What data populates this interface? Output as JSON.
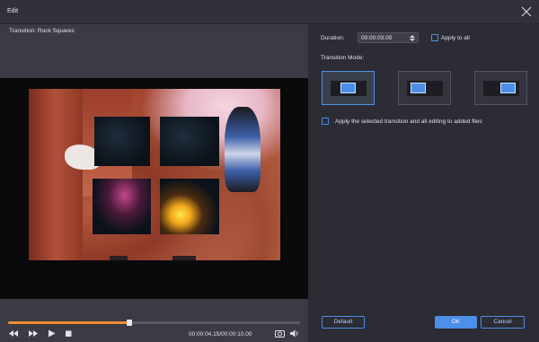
{
  "window": {
    "title": "Edit",
    "close_icon": "close-icon"
  },
  "preview": {
    "transition_label": "Transition: Rock Squares",
    "progress_fraction": 0.415,
    "timecode": "00:00:04.15/00:00:10.00",
    "controls": [
      "rewind-icon",
      "fast-forward-icon",
      "play-icon",
      "stop-icon",
      "snapshot-icon",
      "volume-icon"
    ]
  },
  "settings": {
    "duration_label": "Duration:",
    "duration_value": "00:00:03.00",
    "apply_all_label": "Apply to all",
    "mode_label": "Transition Mode:",
    "modes": [
      "mode-left",
      "mode-center",
      "mode-right"
    ],
    "selected_mode": 0,
    "apply_selected_label": "Apply the selected transition and all editing to added files"
  },
  "buttons": {
    "default": "Default",
    "ok": "OK",
    "cancel": "Cancel"
  },
  "colors": {
    "accent": "#4d8ee8",
    "progress": "#f08a2e",
    "background": "#2b2c34"
  }
}
